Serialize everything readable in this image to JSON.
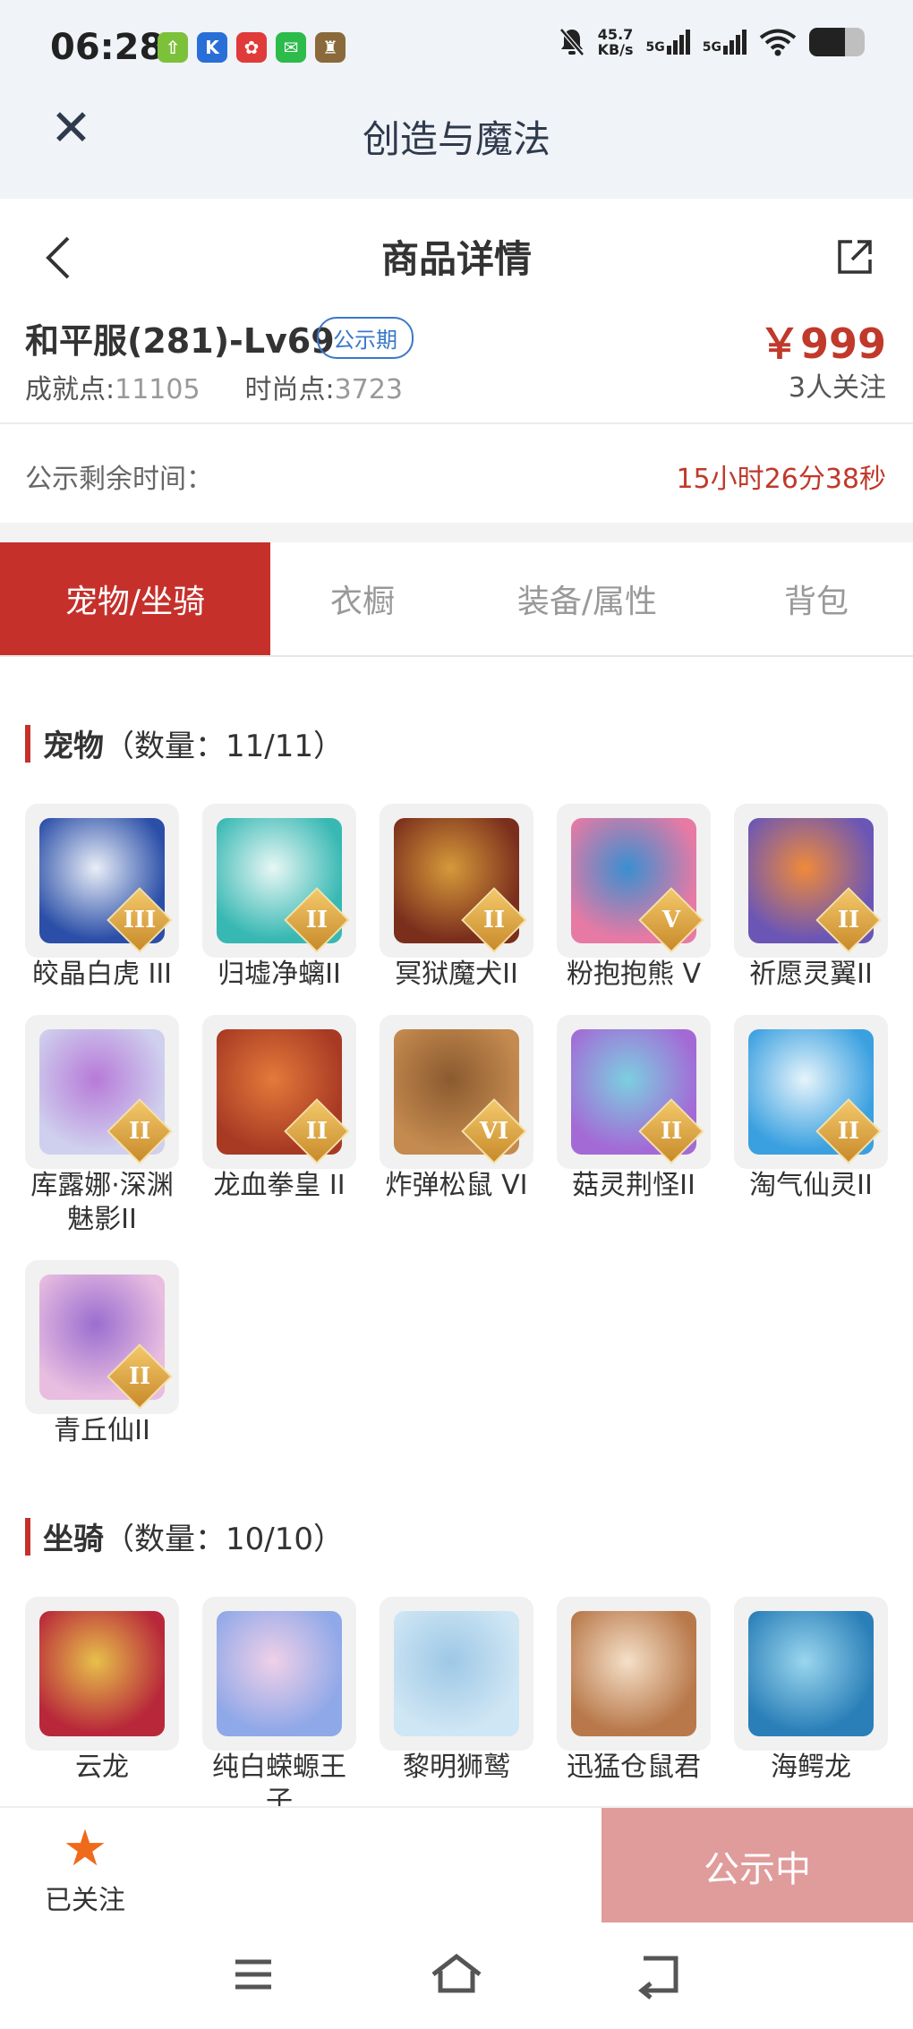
{
  "status_bar": {
    "time": "06:28",
    "net_speed_value": "45.7",
    "net_speed_unit": "KB/s",
    "sim1": "5G",
    "sim2": "5G",
    "apps": [
      {
        "icon": "upload-icon",
        "color": "#7cc13a",
        "glyph": "⇧"
      },
      {
        "icon": "k-app-icon",
        "color": "#2a6fd8",
        "glyph": "K"
      },
      {
        "icon": "red-app-icon",
        "color": "#e03a3a",
        "glyph": "✿"
      },
      {
        "icon": "wechat-icon",
        "color": "#2dbb4b",
        "glyph": "✉"
      },
      {
        "icon": "game-app-icon",
        "color": "#8a6a3a",
        "glyph": "♜"
      }
    ]
  },
  "app_header": {
    "title": "创造与魔法"
  },
  "page_header": {
    "title": "商品详情"
  },
  "listing": {
    "server": "和平服(281)-Lv69",
    "status_badge": "公示期",
    "achievement_label": "成就点:",
    "achievement_value": "11105",
    "fashion_label": "时尚点:",
    "fashion_value": "3723",
    "price": "￥999",
    "watchers": "3人关注"
  },
  "timer": {
    "label": "公示剩余时间：",
    "value": "15小时26分38秒"
  },
  "tabs": [
    {
      "label": "宠物/坐骑",
      "active": true
    },
    {
      "label": "衣橱",
      "active": false
    },
    {
      "label": "装备/属性",
      "active": false
    },
    {
      "label": "背包",
      "active": false
    }
  ],
  "pets_section": {
    "title": "宠物",
    "count": "（数量：11/11）",
    "items": [
      {
        "name": "皎晶白虎 III",
        "rank": "III",
        "colors": [
          "#2b4fa8",
          "#e9eef7"
        ]
      },
      {
        "name": "归墟净螭II",
        "rank": "II",
        "colors": [
          "#37b8b3",
          "#e8f7f5"
        ]
      },
      {
        "name": "冥狱魔犬II",
        "rank": "II",
        "colors": [
          "#7a2f1d",
          "#d69a3a"
        ]
      },
      {
        "name": "粉抱抱熊 V",
        "rank": "V",
        "colors": [
          "#e77aa5",
          "#3a8fd0"
        ]
      },
      {
        "name": "祈愿灵翼II",
        "rank": "II",
        "colors": [
          "#6b56b6",
          "#ef8a3a"
        ]
      },
      {
        "name": "库露娜·深渊魅影II",
        "rank": "II",
        "colors": [
          "#cfd0ee",
          "#b77ad8"
        ]
      },
      {
        "name": "龙血拳皇 II",
        "rank": "II",
        "colors": [
          "#a83a24",
          "#e47a3a"
        ]
      },
      {
        "name": "炸弹松鼠 VI",
        "rank": "VI",
        "colors": [
          "#c48a4f",
          "#8a5a2f"
        ]
      },
      {
        "name": "菇灵荆怪II",
        "rank": "II",
        "colors": [
          "#a36ad6",
          "#7ccfe0"
        ]
      },
      {
        "name": "淘气仙灵II",
        "rank": "II",
        "colors": [
          "#3aa0e0",
          "#e6f4fb"
        ]
      },
      {
        "name": "青丘仙II",
        "rank": "II",
        "colors": [
          "#e8bde0",
          "#9a6ed0"
        ]
      }
    ]
  },
  "mounts_section": {
    "title": "坐骑",
    "count": "（数量：10/10）",
    "items": [
      {
        "name": "云龙",
        "colors": [
          "#b8283a",
          "#e7c04a"
        ]
      },
      {
        "name": "纯白蝾螈王子",
        "colors": [
          "#8fa8e8",
          "#f0d0e8"
        ]
      },
      {
        "name": "黎明狮鹫",
        "colors": [
          "#cfe6f4",
          "#9ec8e6"
        ]
      },
      {
        "name": "迅猛仓鼠君",
        "colors": [
          "#b8784a",
          "#f5e0c8"
        ]
      },
      {
        "name": "海鳄龙",
        "colors": [
          "#2a7fb8",
          "#9ad6ee"
        ]
      }
    ]
  },
  "bottom_bar": {
    "follow_label": "已关注",
    "cta_label": "公示中"
  }
}
